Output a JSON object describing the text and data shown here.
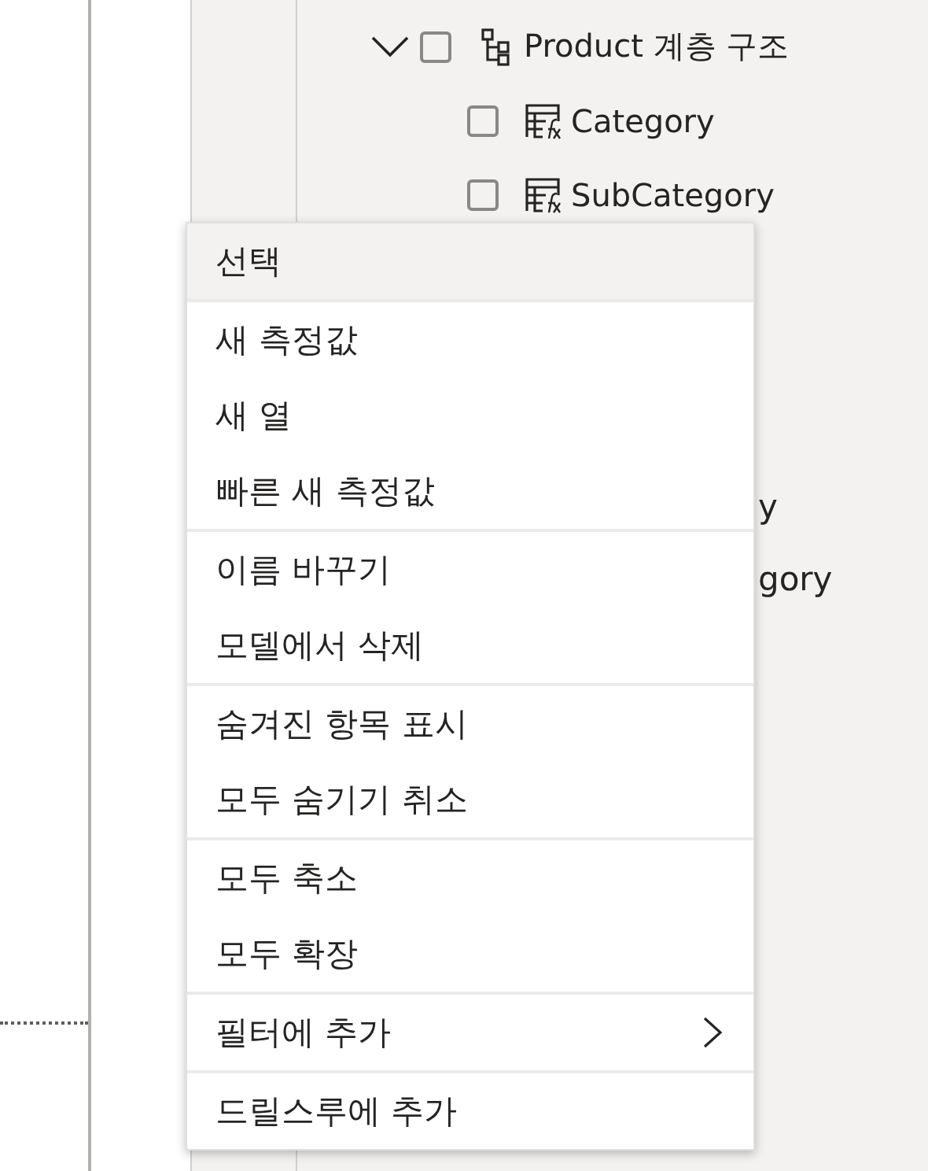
{
  "tree": {
    "label": "Product 계층 구조",
    "expanded": true,
    "checked": false,
    "children": [
      {
        "label": "Category",
        "checked": false
      },
      {
        "label": "SubCategory",
        "checked": false
      }
    ]
  },
  "hidden_row_fragments": [
    {
      "text": "y"
    },
    {
      "text": "gory"
    }
  ],
  "context_menu": {
    "groups": [
      [
        {
          "label": "선택",
          "selected": true,
          "kind": "item"
        }
      ],
      [
        {
          "label": "새 측정값",
          "selected": false,
          "kind": "item"
        },
        {
          "label": "새 열",
          "selected": false,
          "kind": "item"
        },
        {
          "label": "빠른 새 측정값",
          "selected": false,
          "kind": "item"
        }
      ],
      [
        {
          "label": "이름 바꾸기",
          "selected": false,
          "kind": "item"
        },
        {
          "label": "모델에서 삭제",
          "selected": false,
          "kind": "item"
        }
      ],
      [
        {
          "label": "숨겨진 항목 표시",
          "selected": false,
          "kind": "item"
        },
        {
          "label": "모두 숨기기 취소",
          "selected": false,
          "kind": "item"
        }
      ],
      [
        {
          "label": "모두 축소",
          "selected": false,
          "kind": "item"
        },
        {
          "label": "모두 확장",
          "selected": false,
          "kind": "item"
        }
      ],
      [
        {
          "label": "필터에 추가",
          "selected": false,
          "kind": "submenu"
        }
      ],
      [
        {
          "label": "드릴스루에 추가",
          "selected": false,
          "kind": "item"
        }
      ]
    ]
  }
}
